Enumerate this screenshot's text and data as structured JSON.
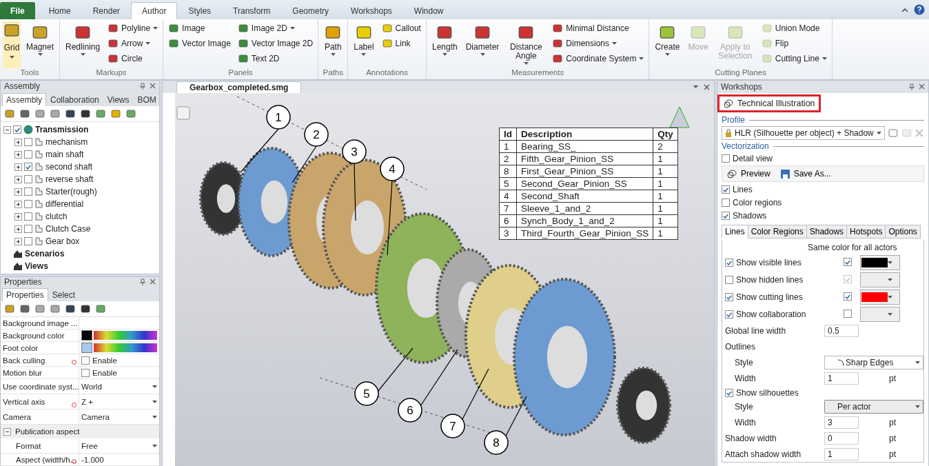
{
  "ribbon": {
    "tabs": [
      {
        "label": "File",
        "kind": "file",
        "selected": false
      },
      {
        "label": "Home",
        "kind": "tab",
        "selected": false
      },
      {
        "label": "Render",
        "kind": "tab",
        "selected": false
      },
      {
        "label": "Author",
        "kind": "tab",
        "selected": true
      },
      {
        "label": "Styles",
        "kind": "tab",
        "selected": false
      },
      {
        "label": "Transform",
        "kind": "tab",
        "selected": false
      },
      {
        "label": "Geometry",
        "kind": "tab",
        "selected": false
      },
      {
        "label": "Workshops",
        "kind": "tab",
        "selected": false
      },
      {
        "label": "Window",
        "kind": "tab",
        "selected": false
      }
    ],
    "groups": [
      {
        "title": "Tools",
        "items": [
          {
            "kind": "large",
            "label": "Grid",
            "dropdown": true,
            "active": true,
            "disabled": false
          },
          {
            "kind": "large",
            "label": "Magnet",
            "dropdown": true,
            "active": false,
            "disabled": false
          }
        ]
      },
      {
        "title": "Markups",
        "items": [
          {
            "kind": "large",
            "label": "Redlining",
            "dropdown": true,
            "active": false,
            "disabled": false
          },
          {
            "kind": "stack",
            "items": [
              {
                "label": "Polyline",
                "dropdown": true,
                "disabled": false
              },
              {
                "label": "Arrow",
                "dropdown": true,
                "disabled": false
              },
              {
                "label": "Circle",
                "dropdown": false,
                "disabled": false
              }
            ]
          }
        ]
      },
      {
        "title": "Panels",
        "items": [
          {
            "kind": "stack",
            "items": [
              {
                "label": "Image",
                "dropdown": false,
                "disabled": false
              },
              {
                "label": "Vector Image",
                "dropdown": false,
                "disabled": false
              }
            ]
          },
          {
            "kind": "stack",
            "items": [
              {
                "label": "Image 2D",
                "dropdown": true,
                "disabled": false
              },
              {
                "label": "Vector Image 2D",
                "dropdown": false,
                "disabled": false
              },
              {
                "label": "Text 2D",
                "dropdown": false,
                "disabled": false
              }
            ]
          }
        ]
      },
      {
        "title": "Paths",
        "items": [
          {
            "kind": "large",
            "label": "Path",
            "dropdown": true,
            "active": false,
            "disabled": false
          }
        ]
      },
      {
        "title": "Annotations",
        "items": [
          {
            "kind": "large",
            "label": "Label",
            "dropdown": true,
            "active": false,
            "disabled": false
          },
          {
            "kind": "stack",
            "items": [
              {
                "label": "Callout",
                "dropdown": false,
                "disabled": false
              },
              {
                "label": "Link",
                "dropdown": false,
                "disabled": false
              }
            ]
          }
        ]
      },
      {
        "title": "Measurements",
        "items": [
          {
            "kind": "large",
            "label": "Length",
            "dropdown": true,
            "active": false,
            "disabled": false
          },
          {
            "kind": "large",
            "label": "Diameter",
            "dropdown": true,
            "active": false,
            "disabled": false
          },
          {
            "kind": "large",
            "label": "Distance Angle",
            "dropdown": true,
            "active": false,
            "disabled": false
          },
          {
            "kind": "stack",
            "items": [
              {
                "label": "Minimal Distance",
                "dropdown": false,
                "disabled": false
              },
              {
                "label": "Dimensions",
                "dropdown": true,
                "disabled": false
              },
              {
                "label": "Coordinate System",
                "dropdown": true,
                "disabled": false
              }
            ]
          }
        ]
      },
      {
        "title": "Cutting Planes",
        "items": [
          {
            "kind": "large",
            "label": "Create",
            "dropdown": true,
            "active": false,
            "disabled": false
          },
          {
            "kind": "large",
            "label": "Move",
            "dropdown": false,
            "active": false,
            "disabled": true
          },
          {
            "kind": "large",
            "label": "Apply to Selection",
            "dropdown": false,
            "active": false,
            "disabled": true
          },
          {
            "kind": "stack",
            "items": [
              {
                "label": "Union Mode",
                "dropdown": false,
                "disabled": true
              },
              {
                "label": "Flip",
                "dropdown": false,
                "disabled": true
              },
              {
                "label": "Cutting Line",
                "dropdown": true,
                "disabled": true
              }
            ]
          }
        ]
      }
    ]
  },
  "assembly": {
    "title": "Assembly",
    "tabs": [
      {
        "label": "Assembly",
        "selected": true
      },
      {
        "label": "Collaboration",
        "selected": false
      },
      {
        "label": "Views",
        "selected": false
      },
      {
        "label": "BOM",
        "selected": false
      }
    ],
    "tree": [
      {
        "kind": "assembly",
        "label": "Transmission",
        "checked": true,
        "expanded": true,
        "children": [
          {
            "kind": "part",
            "label": "mechanism",
            "checked": false,
            "expanded": false
          },
          {
            "kind": "part",
            "label": "main shaft",
            "checked": false,
            "expanded": false
          },
          {
            "kind": "part",
            "label": "second shaft",
            "checked": true,
            "expanded": false
          },
          {
            "kind": "part",
            "label": "reverse shaft",
            "checked": false,
            "expanded": false
          },
          {
            "kind": "part",
            "label": "Starter(rough)",
            "checked": false,
            "expanded": false
          },
          {
            "kind": "part",
            "label": "differential",
            "checked": false,
            "expanded": false
          },
          {
            "kind": "part",
            "label": "clutch",
            "checked": false,
            "expanded": false
          },
          {
            "kind": "part",
            "label": "Clutch Case",
            "checked": false,
            "expanded": false
          },
          {
            "kind": "part",
            "label": "Gear box",
            "checked": false,
            "expanded": false
          }
        ]
      },
      {
        "kind": "folder",
        "label": "Scenarios"
      },
      {
        "kind": "folder",
        "label": "Views"
      }
    ]
  },
  "properties": {
    "title": "Properties",
    "tabs": [
      {
        "label": "Properties",
        "selected": true
      },
      {
        "label": "Select",
        "selected": false
      }
    ],
    "rows": [
      {
        "kind": "text",
        "label": "Background image ...",
        "modified": false
      },
      {
        "kind": "color",
        "label": "Background color",
        "color": "#000000",
        "modified": false
      },
      {
        "kind": "color",
        "label": "Foot color",
        "color": "#a8c8ec",
        "modified": false
      },
      {
        "kind": "check",
        "label": "Back culling",
        "checked": false,
        "text": "Enable",
        "modified": true
      },
      {
        "kind": "check",
        "label": "Motion blur",
        "checked": false,
        "text": "Enable",
        "modified": false
      },
      {
        "kind": "select",
        "label": "Use coordinate syst...",
        "value": "World",
        "modified": false
      },
      {
        "kind": "select",
        "label": "Vertical axis",
        "value": "Z +",
        "modified": true
      },
      {
        "kind": "select",
        "label": "Camera",
        "value": "Camera",
        "modified": false
      },
      {
        "kind": "category",
        "label": "Publication aspect",
        "expanded": true,
        "children": [
          {
            "kind": "select",
            "label": "Format",
            "value": "Free",
            "modified": false
          },
          {
            "kind": "text",
            "label": "Aspect (width/h...",
            "value": "-1.000",
            "modified": true
          }
        ]
      }
    ]
  },
  "viewport": {
    "tab": "Gearbox_completed.smg",
    "callouts": [
      "1",
      "2",
      "3",
      "4",
      "5",
      "6",
      "7",
      "8"
    ],
    "bom": {
      "columns": [
        "Id",
        "Description",
        "Qty"
      ],
      "rows": [
        [
          "1",
          "Bearing_SS_",
          "2"
        ],
        [
          "2",
          "Fifth_Gear_Pinion_SS",
          "1"
        ],
        [
          "8",
          "First_Gear_Pinion_SS",
          "1"
        ],
        [
          "5",
          "Second_Gear_Pinion_SS",
          "1"
        ],
        [
          "4",
          "Second_Shaft",
          "1"
        ],
        [
          "7",
          "Sleeve_1_and_2",
          "1"
        ],
        [
          "6",
          "Synch_Body_1_and_2",
          "1"
        ],
        [
          "3",
          "Third_Fourth_Gear_Pinion_SS",
          "1"
        ]
      ]
    }
  },
  "workshops": {
    "title": "Workshops",
    "header": "Technical Illustration",
    "profile_label": "Profile",
    "profile": "HLR (Silhouette per object) + Shadow",
    "vectorization_label": "Vectorization",
    "detail_view": {
      "label": "Detail view",
      "checked": false
    },
    "actions": [
      "Preview",
      "Save As..."
    ],
    "options": [
      {
        "label": "Lines",
        "checked": true
      },
      {
        "label": "Color regions",
        "checked": false
      },
      {
        "label": "Shadows",
        "checked": true
      }
    ],
    "tabs": [
      {
        "label": "Lines",
        "selected": true
      },
      {
        "label": "Color Regions",
        "selected": false
      },
      {
        "label": "Shadows",
        "selected": false
      },
      {
        "label": "Hotspots",
        "selected": false
      },
      {
        "label": "Options",
        "selected": false
      }
    ],
    "same_color_label": "Same color for all actors",
    "line_rows": [
      {
        "label": "Show visible lines",
        "checked": true,
        "same_color": true,
        "disabled": false,
        "color": "#000000"
      },
      {
        "label": "Show hidden lines",
        "checked": false,
        "same_color": true,
        "disabled": true,
        "color": "#eeeeee"
      },
      {
        "label": "Show cutting lines",
        "checked": true,
        "same_color": true,
        "disabled": false,
        "color": "#ff0000"
      },
      {
        "label": "Show collaboration",
        "checked": true,
        "same_color": false,
        "disabled": false,
        "color": "#eeeeee"
      }
    ],
    "settings": [
      {
        "kind": "input",
        "label": "Global line width",
        "value": "0.5",
        "indented": false
      },
      {
        "kind": "heading",
        "label": "Outlines"
      },
      {
        "kind": "edge-select",
        "label": "Style",
        "value": "Sharp Edges",
        "indented": true
      },
      {
        "kind": "input",
        "label": "Width",
        "value": "1",
        "unit": "pt",
        "indented": true
      },
      {
        "kind": "check",
        "label": "Show silhouettes",
        "checked": true
      },
      {
        "kind": "select",
        "label": "Style",
        "value": "Per actor",
        "indented": true
      },
      {
        "kind": "input",
        "label": "Width",
        "value": "3",
        "unit": "pt",
        "indented": true
      },
      {
        "kind": "input",
        "label": "Shadow width",
        "value": "0",
        "unit": "pt",
        "indented": false
      },
      {
        "kind": "input",
        "label": "Attach shadow width",
        "value": "1",
        "unit": "pt",
        "indented": false
      }
    ]
  }
}
